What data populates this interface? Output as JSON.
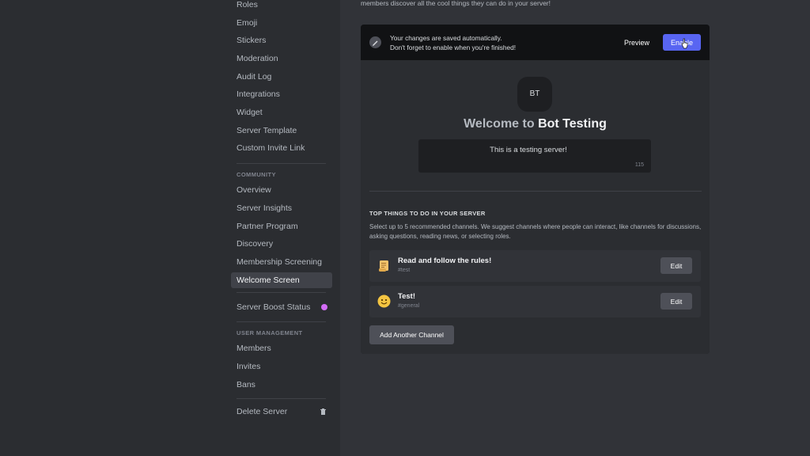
{
  "sidebar": {
    "items": [
      {
        "label": "Roles"
      },
      {
        "label": "Emoji"
      },
      {
        "label": "Stickers"
      },
      {
        "label": "Moderation"
      },
      {
        "label": "Audit Log"
      },
      {
        "label": "Integrations"
      },
      {
        "label": "Widget"
      },
      {
        "label": "Server Template"
      },
      {
        "label": "Custom Invite Link"
      }
    ],
    "community_header": "COMMUNITY",
    "community_items": [
      {
        "label": "Overview"
      },
      {
        "label": "Server Insights"
      },
      {
        "label": "Partner Program"
      },
      {
        "label": "Discovery"
      },
      {
        "label": "Membership Screening"
      },
      {
        "label": "Welcome Screen",
        "selected": true
      }
    ],
    "boost_label": "Server Boost Status",
    "user_management_header": "USER MANAGEMENT",
    "user_items": [
      {
        "label": "Members"
      },
      {
        "label": "Invites"
      },
      {
        "label": "Bans"
      }
    ],
    "delete_label": "Delete Server",
    "icons": {
      "boost": "boost-gem-icon",
      "delete": "trash-icon"
    }
  },
  "main": {
    "top_text": "members discover all the cool things they can do in your server!",
    "notice": {
      "line1": "Your changes are saved automatically.",
      "line2": "Don't forget to enable when you're finished!",
      "icon": "pencil-icon",
      "preview_label": "Preview",
      "enable_label": "Enable"
    },
    "preview": {
      "server_initials": "BT",
      "welcome_prefix": "Welcome to",
      "server_name": "Bot Testing",
      "description": "This is a testing server!",
      "char_count": "115",
      "section_header": "TOP THINGS TO DO IN YOUR SERVER",
      "section_desc": "Select up to 5 recommended channels. We suggest channels where people can interact, like channels for discussions, asking questions, reading news, or selecting roles.",
      "channels": [
        {
          "title": "Read and follow the rules!",
          "channel": "#test",
          "emoji": "scroll-icon",
          "edit_label": "Edit"
        },
        {
          "title": "Test!",
          "channel": "#general",
          "emoji": "smiley-icon",
          "edit_label": "Edit"
        }
      ],
      "add_label": "Add Another Channel"
    }
  },
  "colors": {
    "accent": "#5865f2",
    "boost": "#d36cf7",
    "sidebar_bg": "#2b2d31",
    "main_bg": "#313338"
  }
}
